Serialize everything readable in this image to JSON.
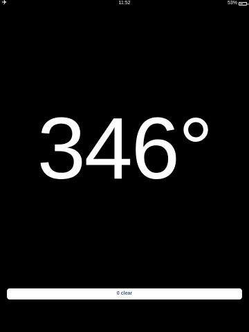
{
  "status_bar": {
    "time": "11:52",
    "battery_percent": "53%",
    "battery_level": 0.53,
    "left_icon": "airplane-icon"
  },
  "main": {
    "reading": "346°"
  },
  "actions": {
    "clear_label": "0 clear"
  },
  "colors": {
    "background": "#000000",
    "foreground": "#ffffff",
    "button_text": "#3b5a8a"
  }
}
